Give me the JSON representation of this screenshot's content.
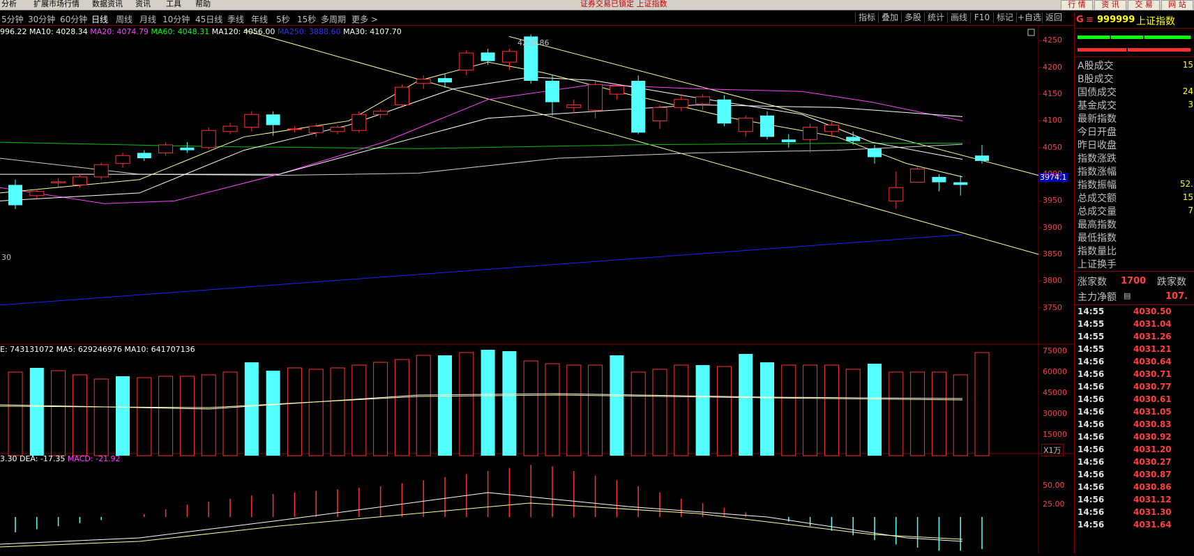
{
  "menu": [
    "分析",
    "扩展市场行情",
    "数据资讯",
    "资讯",
    "工具",
    "帮助"
  ],
  "status_text": "证券交易已锁定  上证指数",
  "top_buttons": [
    "行 情",
    "资 讯",
    "交 易",
    "网 站"
  ],
  "periods": [
    "5分钟",
    "30分钟",
    "60分钟",
    "日线",
    "周线",
    "月线",
    "10分钟",
    "45日线",
    "季线",
    "年线",
    "5秒",
    "15秒",
    "多周期",
    "更多 >"
  ],
  "active_period": "日线",
  "tools": [
    "指标",
    "叠加",
    "多股",
    "统计",
    "画线",
    "F10",
    "标记",
    "+自选",
    "返回"
  ],
  "ma_legend": [
    {
      "text": "996.22",
      "color": "#ffffff"
    },
    {
      "text": "MA10: 4028.34",
      "color": "#ffffff"
    },
    {
      "text": "MA20: 4074.79",
      "color": "#ff40ff"
    },
    {
      "text": "MA60: 4048.31",
      "color": "#00ff00"
    },
    {
      "text": "MA120: 4056.00",
      "color": "#ffffff"
    },
    {
      "text": "MA250: 3888.60",
      "color": "#3030ff"
    },
    {
      "text": "MA30: 4107.70",
      "color": "#ffffff"
    }
  ],
  "price_labels": {
    "high": "4258.86",
    "low": "30",
    "current": "3974.1"
  },
  "vol_legend": [
    {
      "text": "E: 743131072",
      "color": "#ffffff"
    },
    {
      "text": "MA5: 629246976",
      "color": "#ffffff"
    },
    {
      "text": "MA10: 641707136",
      "color": "#ffffff"
    }
  ],
  "vol_unit": "X1万",
  "macd_legend": [
    {
      "text": "3.30",
      "color": "#ffffff"
    },
    {
      "text": "DEA: -17.35",
      "color": "#ffffff"
    },
    {
      "text": "MACD: -21.92",
      "color": "#ff40ff"
    }
  ],
  "chart_data": {
    "type": "candlestick",
    "price_axis": [
      4250,
      4200,
      4150,
      4100,
      4050,
      4000,
      3950,
      3900,
      3850,
      3800,
      3750
    ],
    "vol_axis": [
      75000,
      60000,
      45000,
      30000,
      15000
    ],
    "macd_axis": [
      50.0,
      25.0
    ],
    "candles": [
      [
        3980,
        3942,
        3990,
        3935
      ],
      [
        3960,
        3968,
        3972,
        3955
      ],
      [
        3984,
        3986,
        3993,
        3976
      ],
      [
        3980,
        3995,
        4000,
        3975
      ],
      [
        3995,
        4018,
        4022,
        3990
      ],
      [
        4020,
        4035,
        4040,
        4012
      ],
      [
        4040,
        4030,
        4045,
        4025
      ],
      [
        4040,
        4055,
        4060,
        4035
      ],
      [
        4050,
        4045,
        4060,
        4040
      ],
      [
        4050,
        4082,
        4088,
        4046
      ],
      [
        4080,
        4090,
        4096,
        4075
      ],
      [
        4088,
        4112,
        4118,
        4080
      ],
      [
        4112,
        4092,
        4118,
        4072
      ],
      [
        4085,
        4085,
        4090,
        4078
      ],
      [
        4078,
        4090,
        4095,
        4070
      ],
      [
        4080,
        4088,
        4092,
        4075
      ],
      [
        4082,
        4112,
        4118,
        4078
      ],
      [
        4112,
        4118,
        4122,
        4105
      ],
      [
        4130,
        4163,
        4168,
        4128
      ],
      [
        4170,
        4178,
        4185,
        4160
      ],
      [
        4180,
        4172,
        4188,
        4162
      ],
      [
        4195,
        4227,
        4232,
        4185
      ],
      [
        4228,
        4212,
        4235,
        4205
      ],
      [
        4210,
        4230,
        4235,
        4195
      ],
      [
        4258,
        4175,
        4262,
        4170
      ],
      [
        4175,
        4135,
        4185,
        4110
      ],
      [
        4125,
        4130,
        4140,
        4115
      ],
      [
        4120,
        4168,
        4175,
        4105
      ],
      [
        4150,
        4165,
        4168,
        4140
      ],
      [
        4175,
        4078,
        4185,
        4075
      ],
      [
        4100,
        4125,
        4130,
        4085
      ],
      [
        4125,
        4140,
        4150,
        4118
      ],
      [
        4132,
        4145,
        4150,
        4120
      ],
      [
        4140,
        4095,
        4148,
        4090
      ],
      [
        4080,
        4105,
        4110,
        4070
      ],
      [
        4110,
        4070,
        4118,
        4065
      ],
      [
        4065,
        4060,
        4075,
        4050
      ],
      [
        4065,
        4088,
        4095,
        4040
      ],
      [
        4080,
        4092,
        4098,
        4070
      ],
      [
        4070,
        4062,
        4080,
        4055
      ],
      [
        4048,
        4032,
        4055,
        4020
      ],
      [
        3950,
        3975,
        4005,
        3935
      ],
      [
        3985,
        4010,
        4015,
        3985
      ],
      [
        3995,
        3985,
        4000,
        3968
      ],
      [
        3985,
        3980,
        3998,
        3960
      ],
      [
        4035,
        4025,
        4055,
        4020
      ]
    ],
    "volumes": [
      [
        60000,
        1
      ],
      [
        63000,
        0
      ],
      [
        61000,
        1
      ],
      [
        58000,
        1
      ],
      [
        55000,
        1
      ],
      [
        57000,
        0
      ],
      [
        56000,
        1
      ],
      [
        57000,
        1
      ],
      [
        57000,
        1
      ],
      [
        58000,
        1
      ],
      [
        60000,
        1
      ],
      [
        67000,
        0
      ],
      [
        61000,
        0
      ],
      [
        63000,
        1
      ],
      [
        62000,
        1
      ],
      [
        63000,
        1
      ],
      [
        65000,
        1
      ],
      [
        67000,
        1
      ],
      [
        69000,
        1
      ],
      [
        72000,
        1
      ],
      [
        72000,
        0
      ],
      [
        74000,
        1
      ],
      [
        76000,
        0
      ],
      [
        75000,
        0
      ],
      [
        68000,
        1
      ],
      [
        66000,
        1
      ],
      [
        65000,
        1
      ],
      [
        65000,
        1
      ],
      [
        72000,
        0
      ],
      [
        60000,
        1
      ],
      [
        62000,
        1
      ],
      [
        65000,
        1
      ],
      [
        65000,
        0
      ],
      [
        64000,
        1
      ],
      [
        73000,
        0
      ],
      [
        67000,
        0
      ],
      [
        65000,
        1
      ],
      [
        65000,
        1
      ],
      [
        65000,
        1
      ],
      [
        62000,
        1
      ],
      [
        66000,
        0
      ],
      [
        60000,
        1
      ],
      [
        60000,
        1
      ],
      [
        60000,
        1
      ],
      [
        58000,
        1
      ],
      [
        74000,
        1
      ]
    ],
    "macd": [
      -10,
      -8,
      -6,
      -4,
      -2,
      0,
      2,
      5,
      8,
      10,
      12,
      14,
      15,
      16,
      17,
      18,
      19,
      20,
      22,
      24,
      26,
      28,
      30,
      32,
      34,
      33,
      30,
      27,
      24,
      20,
      16,
      12,
      9,
      6,
      3,
      0,
      -3,
      -6,
      -9,
      -12,
      -15,
      -18,
      -20,
      -22,
      -22,
      -21
    ]
  },
  "info": {
    "code": "999999",
    "name": "上证指数",
    "fields": [
      "A股成交",
      "B股成交",
      "国债成交",
      "基金成交",
      "最新指数",
      "今日开盘",
      "昨日收盘",
      "指数涨跌",
      "指数涨幅",
      "指数振幅",
      "总成交额",
      "总成交量",
      "最高指数",
      "最低指数",
      "指数量比",
      "上证换手"
    ],
    "values": {
      "0": "15",
      "2": "24",
      "3": "3",
      "9": "52.",
      "10": "15",
      "11": "7"
    },
    "rise_label": "涨家数",
    "rise_value": "1700",
    "fall_label": "跌家数",
    "flow_label": "主力净额",
    "flow_value": "107."
  },
  "ticks": [
    [
      "14:55",
      "4030.50"
    ],
    [
      "14:55",
      "4031.04"
    ],
    [
      "14:55",
      "4031.26"
    ],
    [
      "14:55",
      "4031.21"
    ],
    [
      "14:56",
      "4030.64"
    ],
    [
      "14:56",
      "4030.71"
    ],
    [
      "14:56",
      "4030.77"
    ],
    [
      "14:56",
      "4030.61"
    ],
    [
      "14:56",
      "4031.05"
    ],
    [
      "14:56",
      "4030.83"
    ],
    [
      "14:56",
      "4030.92"
    ],
    [
      "14:56",
      "4031.20"
    ],
    [
      "14:56",
      "4030.27"
    ],
    [
      "14:56",
      "4030.87"
    ],
    [
      "14:56",
      "4030.86"
    ],
    [
      "14:56",
      "4031.12"
    ],
    [
      "14:56",
      "4031.30"
    ],
    [
      "14:56",
      "4031.64"
    ]
  ]
}
